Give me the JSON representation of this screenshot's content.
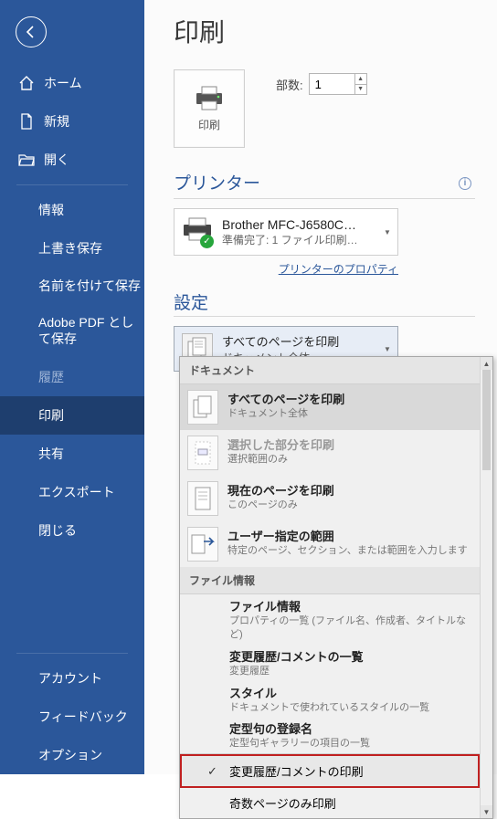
{
  "page_title": "印刷",
  "back_icon": "back-arrow",
  "sidebar": {
    "home": "ホーム",
    "new": "新規",
    "open": "開く",
    "info": "情報",
    "save_overwrite": "上書き保存",
    "save_as": "名前を付けて保存",
    "adobe_pdf": "Adobe PDF として保存",
    "history": "履歴",
    "print": "印刷",
    "share": "共有",
    "export": "エクスポート",
    "close": "閉じる",
    "account": "アカウント",
    "feedback": "フィードバック",
    "options": "オプション"
  },
  "print_button_label": "印刷",
  "copies_label": "部数:",
  "copies_value": "1",
  "printer_section": "プリンター",
  "printer": {
    "name": "Brother MFC-J6580C…",
    "status": "準備完了: 1 ファイル印刷…"
  },
  "printer_props_link": "プリンターのプロパティ",
  "settings_section": "設定",
  "settings_selected": {
    "title": "すべてのページを印刷",
    "sub": "ドキュメント全体"
  },
  "dropdown": {
    "group_document": "ドキュメント",
    "items": [
      {
        "title": "すべてのページを印刷",
        "sub": "ドキュメント全体",
        "icon": "pages-all",
        "selected": true
      },
      {
        "title": "選択した部分を印刷",
        "sub": "選択範囲のみ",
        "icon": "page-sel",
        "disabled": true
      },
      {
        "title": "現在のページを印刷",
        "sub": "このページのみ",
        "icon": "page-one"
      },
      {
        "title": "ユーザー指定の範囲",
        "sub": "特定のページ、セクション、または範囲を入力します",
        "icon": "page-range"
      }
    ],
    "group_fileinfo": "ファイル情報",
    "fileinfo_items": [
      {
        "title": "ファイル情報",
        "sub": "プロパティの一覧 (ファイル名、作成者、タイトルなど)"
      },
      {
        "title": "変更履歴/コメントの一覧",
        "sub": "変更履歴"
      },
      {
        "title": "スタイル",
        "sub": "ドキュメントで使われているスタイルの一覧"
      },
      {
        "title": "定型句の登録名",
        "sub": "定型句ギャラリーの項目の一覧"
      }
    ],
    "checked_item": "変更履歴/コメントの印刷",
    "plain_item": "奇数ページのみ印刷"
  }
}
